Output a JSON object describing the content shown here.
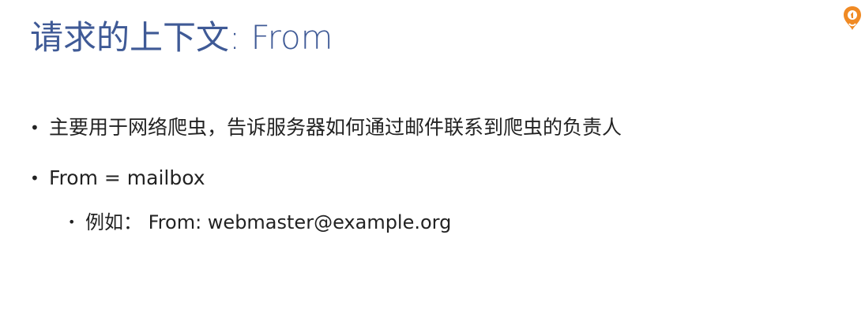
{
  "slide": {
    "title": "请求的上下文: From",
    "bullets": [
      {
        "text": "主要用于网络爬虫，告诉服务器如何通过邮件联系到爬虫的负责人"
      },
      {
        "text": "From = mailbox"
      },
      {
        "text": "例如：  From: webmaster@example.org"
      }
    ],
    "bullet_char": "•",
    "logo_icon": "orange-drop-logo-icon"
  },
  "colors": {
    "title": "#3f5a96",
    "body_text": "#222222",
    "logo": "#f08a24"
  }
}
